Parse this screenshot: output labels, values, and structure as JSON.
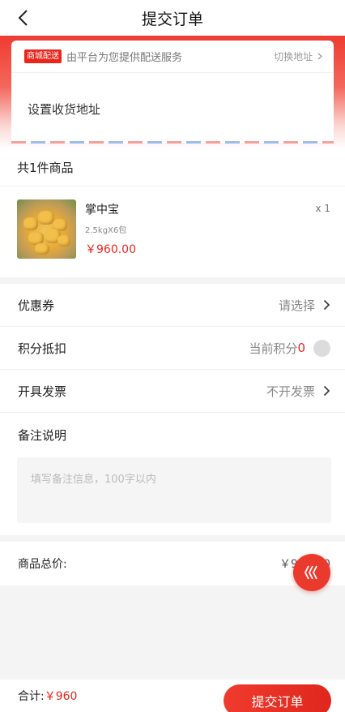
{
  "header": {
    "title": "提交订单"
  },
  "address": {
    "badge": "商城配送",
    "delivery_text": "由平台为您提供配送服务",
    "switch_label": "切换地址",
    "set_label": "设置收货地址"
  },
  "goods": {
    "count_label": "共1件商品",
    "items": [
      {
        "name": "掌中宝",
        "spec": "2.5kgX6包",
        "price": "￥960.00",
        "qty": "x 1"
      }
    ]
  },
  "options": {
    "coupon": {
      "label": "优惠券",
      "value": "请选择"
    },
    "points": {
      "label": "积分抵扣",
      "text": "当前积分",
      "value": "0"
    },
    "invoice": {
      "label": "开具发票",
      "value": "不开发票"
    },
    "remark": {
      "label": "备注说明",
      "placeholder": "填写备注信息，100字以内"
    }
  },
  "total": {
    "label": "商品总价:",
    "value": "￥960.00"
  },
  "bottom": {
    "sum_label": "合计:",
    "sum_value": "￥960",
    "submit_label": "提交订单"
  },
  "icons": {
    "back": "chevron-left-icon",
    "float": "triple-chevron-left-icon"
  },
  "colors": {
    "accent": "#e8261c"
  }
}
